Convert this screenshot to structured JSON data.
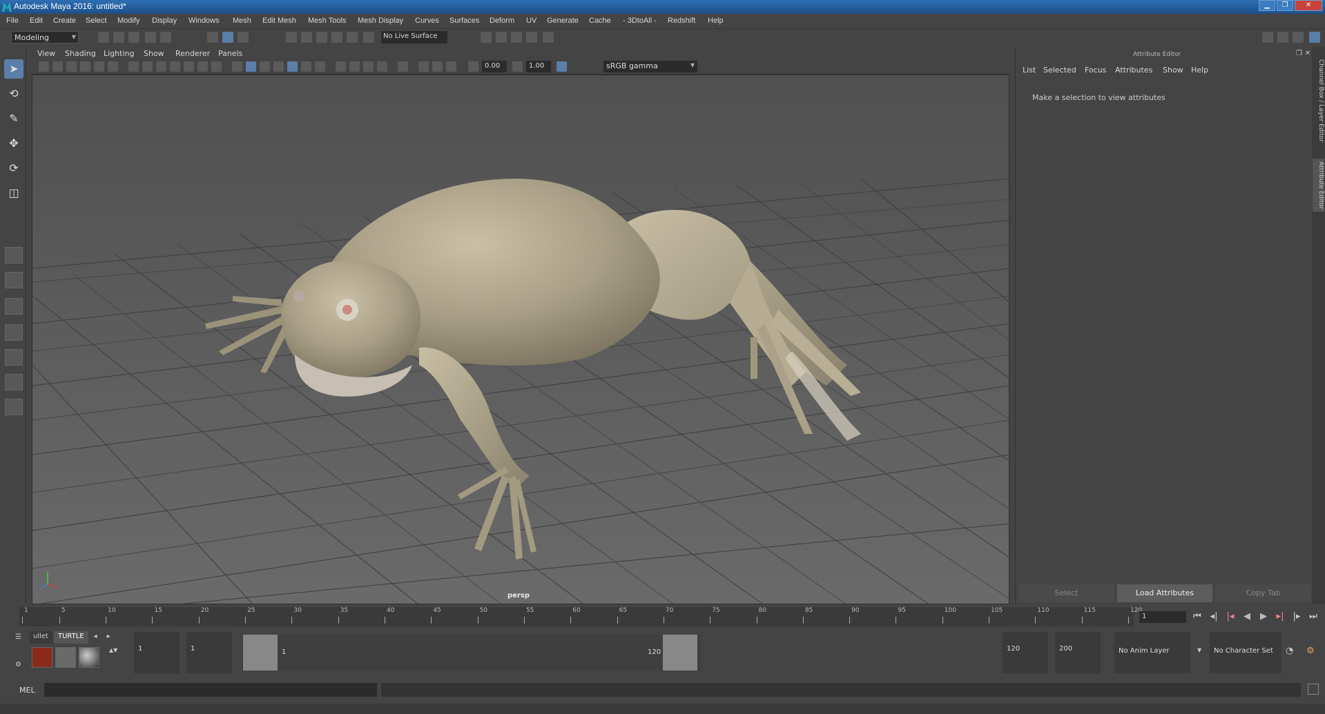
{
  "window": {
    "title": "Autodesk Maya 2016: untitled*"
  },
  "menubar": {
    "items": [
      "File",
      "Edit",
      "Create",
      "Select",
      "Modify",
      "Display",
      "Windows",
      "Mesh",
      "Edit Mesh",
      "Mesh Tools",
      "Mesh Display",
      "Curves",
      "Surfaces",
      "Deform",
      "UV",
      "Generate",
      "Cache",
      "- 3DtoAll -",
      "Redshift",
      "Help"
    ]
  },
  "statusline": {
    "mode": "Modeling",
    "live_surface": "No Live Surface"
  },
  "panel": {
    "menus": [
      "View",
      "Shading",
      "Lighting",
      "Show",
      "Renderer",
      "Panels"
    ],
    "exposure": "0.00",
    "gamma": "1.00",
    "color_space": "sRGB gamma",
    "camera_label": "persp"
  },
  "attribute_editor": {
    "title": "Attribute Editor",
    "menus": [
      "List",
      "Selected",
      "Focus",
      "Attributes",
      "Show",
      "Help"
    ],
    "message": "Make a selection to view attributes",
    "buttons": {
      "select": "Select",
      "load": "Load Attributes",
      "copy": "Copy Tab"
    },
    "side_tabs": [
      "Channel Box / Layer Editor",
      "Attribute Editor"
    ]
  },
  "timeline": {
    "start": 1,
    "end": 120,
    "ticks": [
      "1",
      "5",
      "10",
      "15",
      "20",
      "25",
      "30",
      "35",
      "40",
      "45",
      "50",
      "55",
      "60",
      "65",
      "70",
      "75",
      "80",
      "85",
      "90",
      "95",
      "100",
      "105",
      "110",
      "115",
      "120"
    ],
    "current_frame": "1"
  },
  "range": {
    "shelf_tabs": [
      "ullet",
      "TURTLE"
    ],
    "start_time": "1",
    "playback_start": "1",
    "slider_start": "1",
    "slider_end": "120",
    "playback_end": "120",
    "end_time": "200",
    "anim_layer": "No Anim Layer",
    "character_set": "No Character Set"
  },
  "commandline": {
    "language": "MEL"
  },
  "colors": {
    "accent": "#5b7fa8",
    "viewport_bg": "#5a5a5a",
    "panel_bg": "#444444",
    "frog_skin": "#a89f86"
  }
}
